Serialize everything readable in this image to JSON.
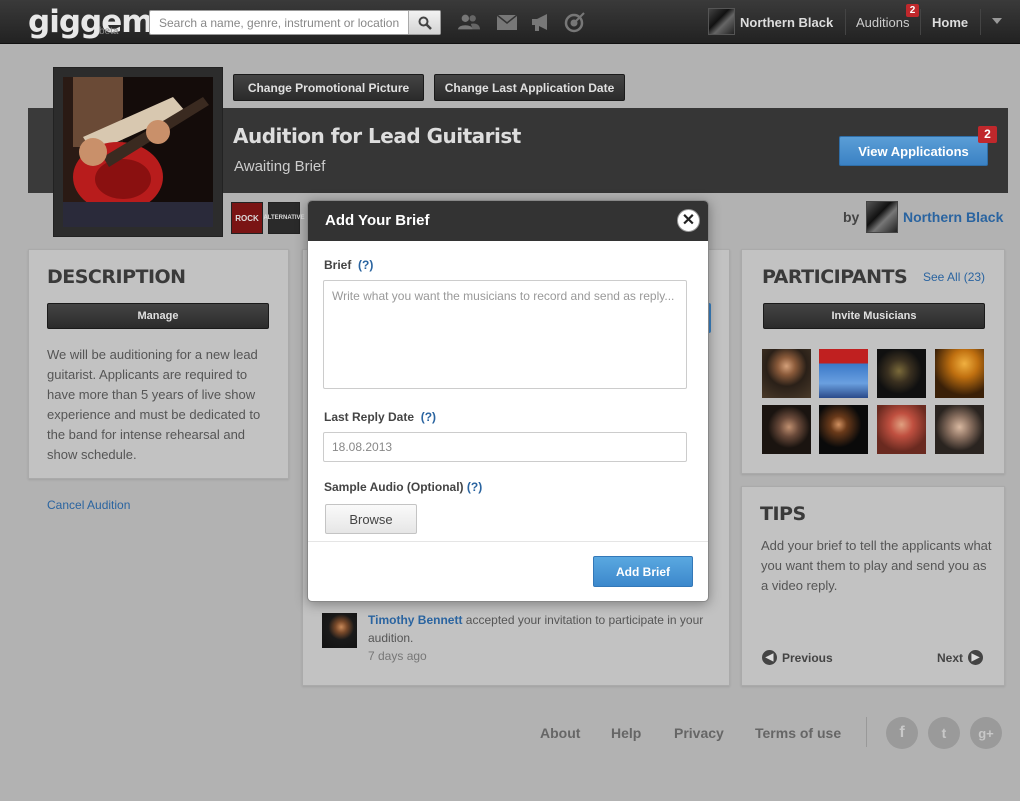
{
  "topbar": {
    "logo": "giggem",
    "logo_tag": "beta",
    "search_placeholder": "Search a name, genre, instrument or location",
    "user_name": "Northern Black",
    "auditions_label": "Auditions",
    "auditions_badge": "2",
    "home_label": "Home"
  },
  "header": {
    "change_picture_label": "Change Promotional Picture",
    "change_date_label": "Change Last Application Date",
    "audition_title": "Audition for Lead Guitarist",
    "audition_status": "Awaiting Brief",
    "view_applications_label": "View Applications",
    "applications_badge": "2",
    "genres": [
      "ROCK",
      "ALTERNATIVE"
    ],
    "by_label": "by",
    "owner_name": "Northern Black"
  },
  "description": {
    "title": "DESCRIPTION",
    "manage_label": "Manage",
    "text": "We will be auditioning for a new lead guitarist. Applicants are required to have more than 5 years of live show experience and must be dedicated to the band for intense rehearsal and show schedule.",
    "cancel_label": "Cancel Audition"
  },
  "participants": {
    "title": "PARTICIPANTS",
    "see_all_label": "See All (23)",
    "invite_label": "Invite Musicians"
  },
  "tips": {
    "title": "TIPS",
    "text": "Add your brief to tell the applicants what you want them to play and send you as a video reply.",
    "previous_label": "Previous",
    "next_label": "Next"
  },
  "activity": {
    "name": "Timothy Bennett",
    "text": "accepted your invitation to participate in your audition.",
    "time": "7 days ago"
  },
  "footer": {
    "links": [
      "About",
      "Help",
      "Privacy",
      "Terms of use"
    ],
    "social": [
      "f",
      "t",
      "g+"
    ]
  },
  "modal": {
    "title": "Add Your Brief",
    "brief_label": "Brief",
    "help_mark": "(?)",
    "brief_placeholder": "Write what you want the musicians to record and send as reply...",
    "date_label": "Last Reply Date",
    "date_value": "18.08.2013",
    "audio_label": "Sample Audio (Optional)",
    "browse_label": "Browse",
    "submit_label": "Add Brief"
  }
}
